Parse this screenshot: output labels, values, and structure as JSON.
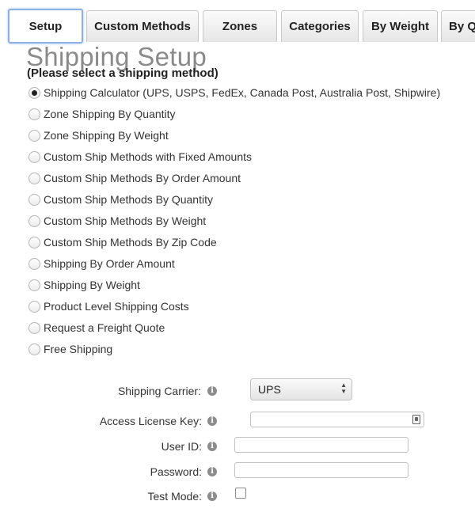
{
  "tabs": [
    {
      "label": "Setup",
      "active": true
    },
    {
      "label": "Custom Methods"
    },
    {
      "label": "Zones"
    },
    {
      "label": "Categories"
    },
    {
      "label": "By Weight"
    },
    {
      "label": "By Q"
    }
  ],
  "page": {
    "title": "Shipping Setup",
    "subtitle": "(Please select a shipping method)"
  },
  "methods": [
    {
      "label": "Shipping Calculator (UPS, USPS, FedEx, Canada Post, Australia Post, Shipwire)",
      "checked": true
    },
    {
      "label": "Zone Shipping By Quantity"
    },
    {
      "label": "Zone Shipping By Weight"
    },
    {
      "label": "Custom Ship Methods with Fixed Amounts"
    },
    {
      "label": "Custom Ship Methods By Order Amount"
    },
    {
      "label": "Custom Ship Methods By Quantity"
    },
    {
      "label": "Custom Ship Methods By Weight"
    },
    {
      "label": "Custom Ship Methods By Zip Code"
    },
    {
      "label": "Shipping By Order Amount"
    },
    {
      "label": "Shipping By Weight"
    },
    {
      "label": "Product Level Shipping Costs"
    },
    {
      "label": "Request a Freight Quote"
    },
    {
      "label": "Free Shipping"
    }
  ],
  "form": {
    "carrier": {
      "label": "Shipping Carrier:",
      "value": "UPS"
    },
    "license_key": {
      "label": "Access License Key:",
      "value": ""
    },
    "user_id": {
      "label": "User ID:",
      "value": ""
    },
    "password": {
      "label": "Password:",
      "value": ""
    },
    "test_mode": {
      "label": "Test Mode:",
      "checked": false
    }
  },
  "icons": {
    "info": "info-icon",
    "select_arrows": "select-arrows-icon",
    "key": "key-icon"
  }
}
